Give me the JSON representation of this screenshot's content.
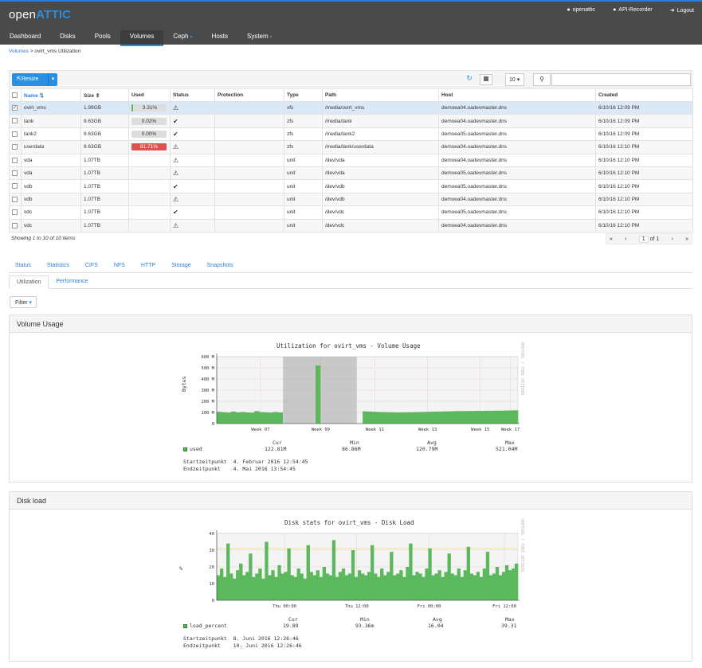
{
  "app": {
    "logo_prefix": "open",
    "logo_brand": "ATTIC",
    "user": "openattic",
    "api_recorder": "API-Recorder",
    "logout": "Logout"
  },
  "nav": {
    "items": [
      {
        "label": "Dashboard"
      },
      {
        "label": "Disks"
      },
      {
        "label": "Pools"
      },
      {
        "label": "Volumes",
        "active": true
      },
      {
        "label": "Ceph",
        "dropdown": true
      },
      {
        "label": "Hosts"
      },
      {
        "label": "System",
        "dropdown": true
      }
    ]
  },
  "breadcrumb": {
    "parent": "Volumes",
    "separator": ">",
    "current": "ovirt_vms Utilization"
  },
  "toolbar": {
    "resize_label": "Resize",
    "page_size": "10",
    "search_value": ""
  },
  "table": {
    "headers": {
      "name": "Name",
      "size": "Size",
      "used": "Used",
      "status": "Status",
      "protection": "Protection",
      "type": "Type",
      "path": "Path",
      "host": "Host",
      "created": "Created"
    },
    "rows": [
      {
        "checked": true,
        "name": "ovirt_vms",
        "size": "1.99GB",
        "used": "3.31%",
        "used_style": "green",
        "status": "warn",
        "protection": "",
        "type": "xfs",
        "path": "/media/ovirt_vms",
        "host": "demoea04.oadevmaster.dns",
        "created": "6/10/16 12:09 PM"
      },
      {
        "checked": false,
        "name": "tank",
        "size": "9.63GB",
        "used": "0.02%",
        "used_style": "grey",
        "status": "ok",
        "protection": "",
        "type": "zfs",
        "path": "/media/tank",
        "host": "demoea04.oadevmaster.dns",
        "created": "6/10/16 12:09 PM"
      },
      {
        "checked": false,
        "name": "tank2",
        "size": "9.63GB",
        "used": "0.00%",
        "used_style": "grey",
        "status": "ok",
        "protection": "",
        "type": "zfs",
        "path": "/media/tank2",
        "host": "demoea05.oadevmaster.dns",
        "created": "6/10/16 12:09 PM"
      },
      {
        "checked": false,
        "name": "userdata",
        "size": "9.63GB",
        "used": "81.71%",
        "used_style": "red",
        "status": "warn",
        "protection": "",
        "type": "zfs",
        "path": "/media/tank/userdata",
        "host": "demoea04.oadevmaster.dns",
        "created": "6/10/16 12:10 PM"
      },
      {
        "checked": false,
        "name": "vda",
        "size": "1.07TB",
        "used": "",
        "used_style": "",
        "status": "warn",
        "protection": "",
        "type": "unit",
        "path": "/dev/vda",
        "host": "demoea04.oadevmaster.dns",
        "created": "6/10/16 12:10 PM"
      },
      {
        "checked": false,
        "name": "vda",
        "size": "1.07TB",
        "used": "",
        "used_style": "",
        "status": "warn",
        "protection": "",
        "type": "unit",
        "path": "/dev/vda",
        "host": "demoea05.oadevmaster.dns",
        "created": "6/10/16 12:10 PM"
      },
      {
        "checked": false,
        "name": "vdb",
        "size": "1.07TB",
        "used": "",
        "used_style": "",
        "status": "ok",
        "protection": "",
        "type": "unit",
        "path": "/dev/vdb",
        "host": "demoea05.oadevmaster.dns",
        "created": "6/10/16 12:10 PM"
      },
      {
        "checked": false,
        "name": "vdb",
        "size": "1.07TB",
        "used": "",
        "used_style": "",
        "status": "warn",
        "protection": "",
        "type": "unit",
        "path": "/dev/vdb",
        "host": "demoea04.oadevmaster.dns",
        "created": "6/10/16 12:10 PM"
      },
      {
        "checked": false,
        "name": "vdc",
        "size": "1.07TB",
        "used": "",
        "used_style": "",
        "status": "ok",
        "protection": "",
        "type": "unit",
        "path": "/dev/vdc",
        "host": "demoea05.oadevmaster.dns",
        "created": "6/10/16 12:10 PM"
      },
      {
        "checked": false,
        "name": "vdc",
        "size": "1.07TB",
        "used": "",
        "used_style": "",
        "status": "warn",
        "protection": "",
        "type": "unit",
        "path": "/dev/vdc",
        "host": "demoea04.oadevmaster.dns",
        "created": "6/10/16 12:10 PM"
      }
    ]
  },
  "showing": "Showing 1 to 10 of 10 items",
  "pager": {
    "first": "«",
    "prev": "‹",
    "page": "1",
    "of": "of 1",
    "next": "›",
    "last": "»"
  },
  "tabs": [
    "Status",
    "Statistics",
    "CIFS",
    "NFS",
    "HTTP",
    "Storage",
    "Snapshots"
  ],
  "subtabs": [
    {
      "label": "Utilization",
      "active": true
    },
    {
      "label": "Performance",
      "active": false
    }
  ],
  "filter_label": "Filter",
  "panels": {
    "volume_usage": {
      "heading": "Volume Usage",
      "side_text": "RRDTOOL / TOBI OETIKER",
      "legend": {
        "cur_h": "Cur",
        "min_h": "Min",
        "avg_h": "Avg",
        "max_h": "Max",
        "name": "used",
        "cur": "122.81M",
        "min": "86.86M",
        "avg": "120.79M",
        "max": "521.04M"
      },
      "start_label": "Startzeitpunkt",
      "start_value": "4. Februar 2016 12:54:45",
      "end_label": "Endzeitpunkt",
      "end_value": "4. Mai 2016 13:54:45"
    },
    "disk_load": {
      "heading": "Disk load",
      "side_text": "RRDTOOL / TOBI OETIKER",
      "legend": {
        "cur_h": "Cur",
        "min_h": "Min",
        "avg_h": "Avg",
        "max_h": "Max",
        "name": "load_percent",
        "cur": "19.89",
        "min": "93.36m",
        "avg": "16.04",
        "max": "39.31"
      },
      "start_label": "Startzeitpunkt",
      "start_value": "8. Juni 2016 12:26:46",
      "end_label": "Endzeitpunkt",
      "end_value": "10. Juni 2016 12:26:46"
    }
  },
  "chart_data": [
    {
      "type": "area",
      "title": "Utilization for ovirt_vms - Volume Usage",
      "xlabel": "",
      "ylabel": "Bytes",
      "x_ticks": [
        "Week 07",
        "Week 09",
        "Week 11",
        "Week 13",
        "Week 15",
        "Week 17"
      ],
      "y_ticks": [
        "0",
        "100 M",
        "200 M",
        "300 M",
        "400 M",
        "500 M",
        "600 M"
      ],
      "ylim": [
        0,
        600
      ],
      "grid": true,
      "highlight_range_weeks": [
        "Week 08.5",
        "Week 11"
      ],
      "series": [
        {
          "name": "used",
          "color": "#5cb85c",
          "values": [
            105,
            102,
            99,
            108,
            101,
            104,
            100,
            98,
            112,
            103,
            101,
            99,
            104,
            100,
            0,
            0,
            0,
            0,
            0,
            0,
            0,
            521,
            0,
            0,
            0,
            0,
            0,
            0,
            0,
            0,
            0,
            110,
            108,
            106,
            104,
            103,
            102,
            101,
            100,
            100,
            101,
            102,
            103,
            104,
            105,
            106,
            107,
            108,
            109,
            110,
            111,
            112,
            112,
            113,
            113,
            114,
            114,
            115,
            115,
            116,
            116,
            117,
            118,
            119
          ]
        }
      ]
    },
    {
      "type": "area",
      "title": "Disk stats for ovirt_vms - Disk Load",
      "xlabel": "",
      "ylabel": "%",
      "x_ticks": [
        "Thu 00:00",
        "Thu 12:00",
        "Fri 00:00",
        "Fri 12:00"
      ],
      "y_ticks": [
        "0",
        "10",
        "20",
        "30",
        "40"
      ],
      "ylim": [
        0,
        40
      ],
      "grid": true,
      "reference_line": 31,
      "series": [
        {
          "name": "load_percent",
          "color": "#5cb85c",
          "values": [
            15,
            19,
            14,
            34,
            16,
            13,
            18,
            22,
            15,
            17,
            28,
            14,
            16,
            19,
            13,
            35,
            15,
            18,
            14,
            21,
            16,
            17,
            31,
            15,
            14,
            19,
            16,
            13,
            33,
            17,
            15,
            18,
            14,
            20,
            16,
            15,
            36,
            14,
            17,
            19,
            15,
            16,
            30,
            14,
            18,
            16,
            15,
            17,
            33,
            16,
            14,
            19,
            15,
            17,
            29,
            15,
            16,
            18,
            14,
            20,
            34,
            15,
            17,
            16,
            14,
            19,
            31,
            15,
            16,
            18,
            14,
            17,
            28,
            16,
            15,
            19,
            14,
            18,
            32,
            16,
            15,
            17,
            14,
            19,
            29,
            15,
            16,
            20,
            15,
            17,
            21,
            18,
            19,
            22
          ]
        }
      ]
    }
  ]
}
